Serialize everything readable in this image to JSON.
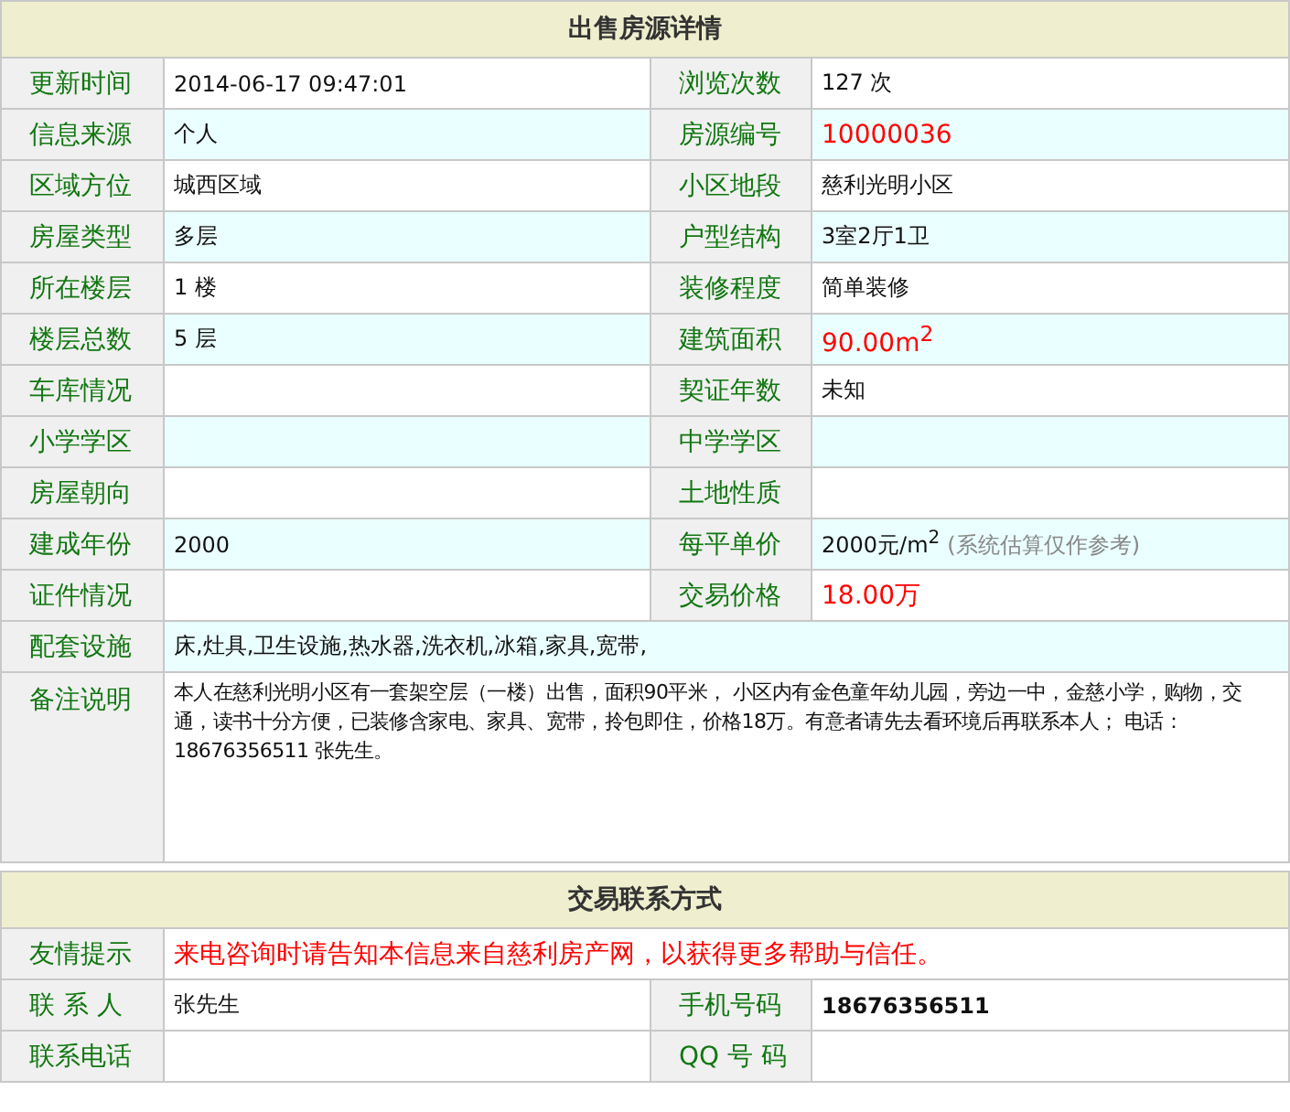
{
  "detail": {
    "title": "出售房源详情",
    "rows": [
      {
        "fields": [
          {
            "label": "更新时间",
            "value": "2014-06-17 09:47:01",
            "kind": "plain"
          },
          {
            "label": "浏览次数",
            "value": "127 次",
            "kind": "plain"
          }
        ]
      },
      {
        "fields": [
          {
            "label": "信息来源",
            "value": "个人",
            "kind": "plain"
          },
          {
            "label": "房源编号",
            "value": "10000036",
            "kind": "red"
          }
        ]
      },
      {
        "fields": [
          {
            "label": "区域方位",
            "value": "城西区域",
            "kind": "plain"
          },
          {
            "label": "小区地段",
            "value": "慈利光明小区",
            "kind": "plain"
          }
        ]
      },
      {
        "fields": [
          {
            "label": "房屋类型",
            "value": "多层",
            "kind": "plain"
          },
          {
            "label": "户型结构",
            "value": "3室2厅1卫",
            "kind": "plain"
          }
        ]
      },
      {
        "fields": [
          {
            "label": "所在楼层",
            "value": "1 楼",
            "kind": "plain"
          },
          {
            "label": "装修程度",
            "value": "简单装修",
            "kind": "plain"
          }
        ]
      },
      {
        "fields": [
          {
            "label": "楼层总数",
            "value": "5 层",
            "kind": "plain"
          },
          {
            "label": "建筑面积",
            "value": "90.00m$^{2}$",
            "kind": "red"
          }
        ]
      },
      {
        "fields": [
          {
            "label": "车库情况",
            "kind": "plain"
          },
          {
            "label": "契证年数",
            "value": "未知",
            "kind": "plain"
          }
        ]
      },
      {
        "fields": [
          {
            "label": "小学学区",
            "kind": "plain"
          },
          {
            "label": "中学学区",
            "kind": "plain"
          }
        ]
      },
      {
        "fields": [
          {
            "label": "房屋朝向",
            "kind": "plain"
          },
          {
            "label": "土地性质",
            "kind": "plain"
          }
        ]
      },
      {
        "fields": [
          {
            "label": "建成年份",
            "value": "2000",
            "kind": "plain"
          },
          {
            "label": "每平单价",
            "value": "2000元/m$^{2}$",
            "note": "(系统估算仅作参考)",
            "kind": "plain"
          }
        ]
      },
      {
        "fields": [
          {
            "label": "证件情况",
            "kind": "plain"
          },
          {
            "label": "交易价格",
            "value": "18.00万",
            "kind": "red"
          }
        ]
      },
      {
        "fields": [
          {
            "label": "配套设施",
            "value": "床,灶具,卫生设施,热水器,洗衣机,冰箱,家具,宽带,",
            "kind": "plain"
          }
        ]
      },
      {
        "fields": [
          {
            "label": "备注说明",
            "value": "本人在慈利光明小区有一套架空层（一楼）出售，面积90平米， 小区内有金色童年幼儿园，旁边一中，金慈小学，购物，交通，读书十分方便，已装修含家电、家具、宽带，拎包即住，价格18万。有意者请先去看环境后再联系本人； 电话：18676356511 张先生。",
            "kind": "memo"
          }
        ]
      }
    ]
  },
  "contact": {
    "title": "交易联系方式",
    "rows": [
      {
        "fields": [
          {
            "label": "友情提示",
            "value": "来电咨询时请告知本信息来自慈利房产网，以获得更多帮助与信任。",
            "kind": "red"
          }
        ]
      },
      {
        "fields": [
          {
            "label": "联 系 人",
            "value": "张先生",
            "kind": "plain"
          },
          {
            "label": "手机号码",
            "value": "18676356511",
            "kind": "bold"
          }
        ]
      },
      {
        "fields": [
          {
            "label": "联系电话",
            "kind": "plain"
          },
          {
            "label": "QQ 号 码",
            "kind": "plain"
          }
        ]
      }
    ]
  }
}
